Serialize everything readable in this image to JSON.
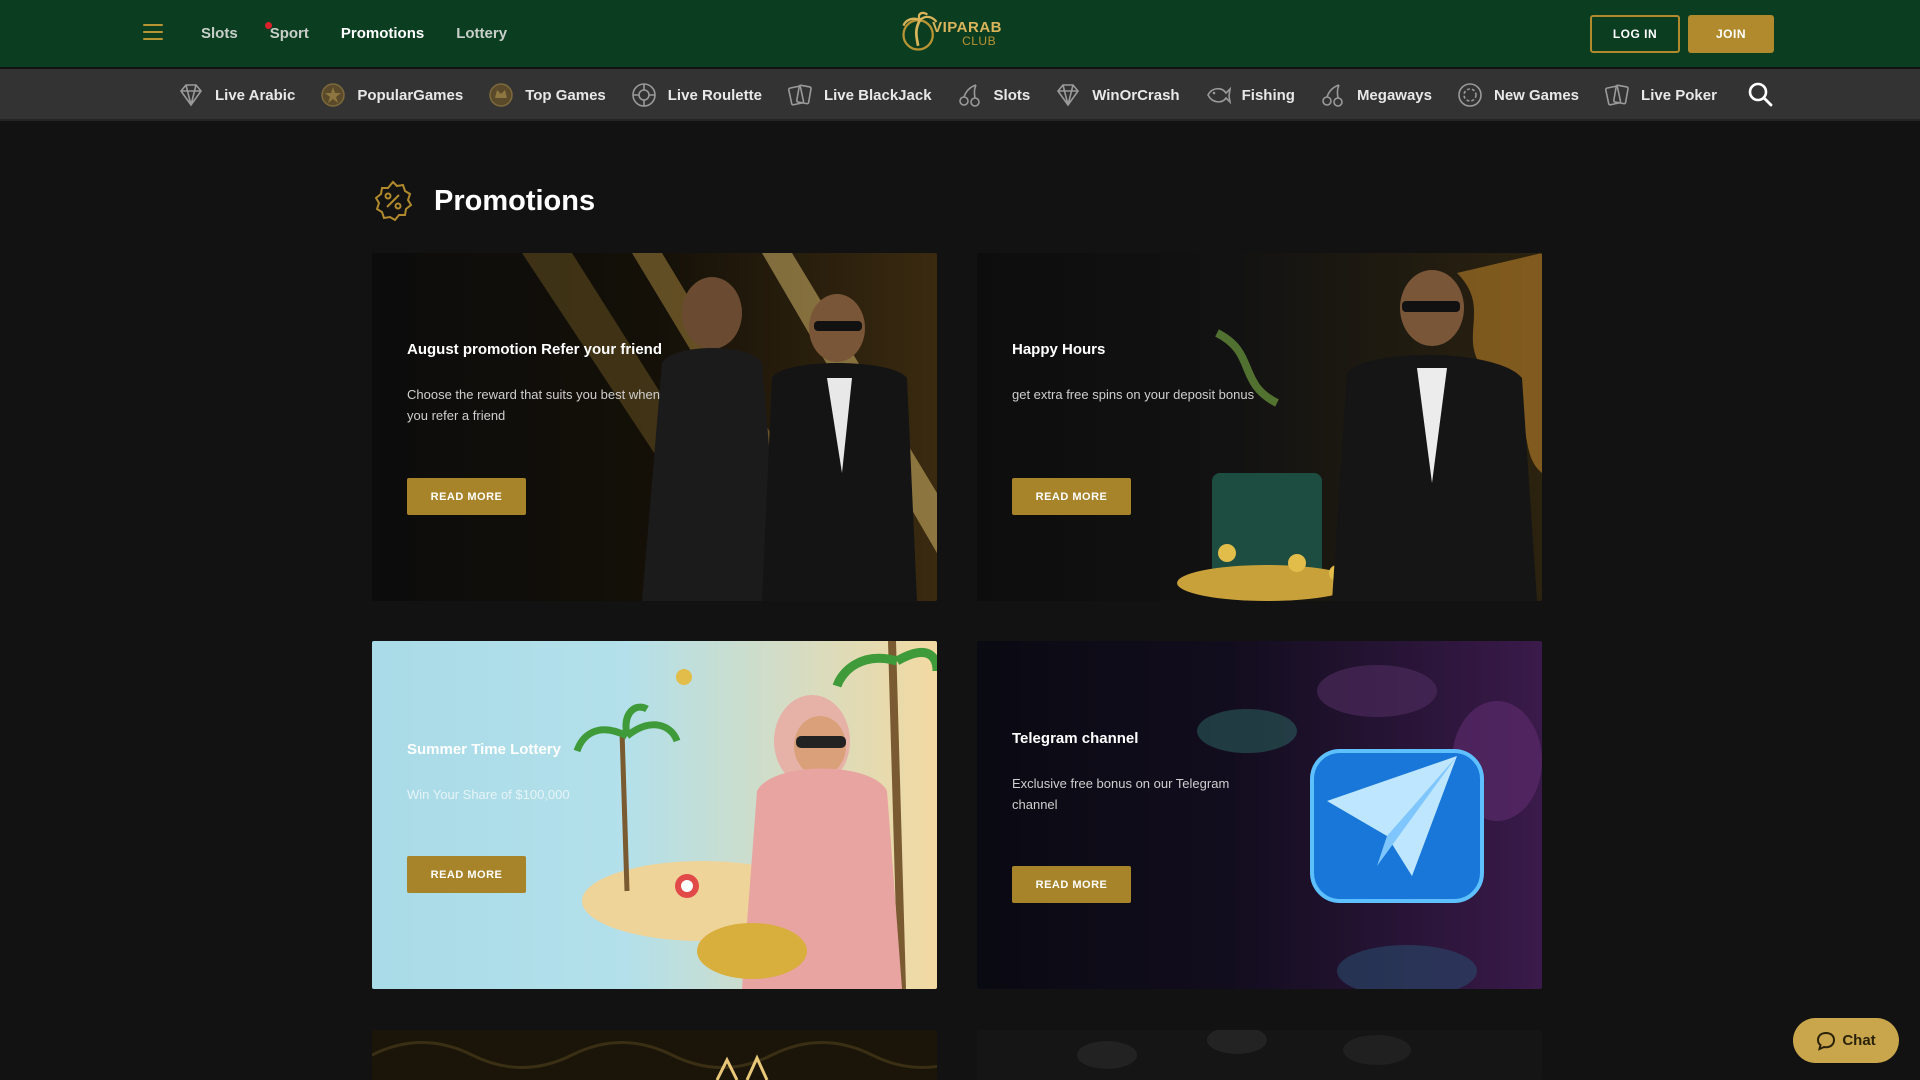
{
  "header": {
    "nav": [
      {
        "label": "Slots",
        "active": false,
        "dot": false
      },
      {
        "label": "Sport",
        "active": false,
        "dot": true
      },
      {
        "label": "Promotions",
        "active": true,
        "dot": false
      },
      {
        "label": "Lottery",
        "active": false,
        "dot": false
      }
    ],
    "logo": {
      "line1": "VIPARAB",
      "line2": "CLUB"
    },
    "login_label": "LOG IN",
    "join_label": "JOIN"
  },
  "categories": [
    {
      "label": "Live Arabic",
      "icon": "diamond-icon"
    },
    {
      "label": "PopularGames",
      "icon": "popular-games-icon"
    },
    {
      "label": "Top Games",
      "icon": "top-games-icon"
    },
    {
      "label": "Live Roulette",
      "icon": "roulette-icon"
    },
    {
      "label": "Live BlackJack",
      "icon": "cards-icon"
    },
    {
      "label": "Slots",
      "icon": "cherries-icon"
    },
    {
      "label": "WinOrCrash",
      "icon": "diamond-icon"
    },
    {
      "label": "Fishing",
      "icon": "fish-icon"
    },
    {
      "label": "Megaways",
      "icon": "cherries-icon"
    },
    {
      "label": "New Games",
      "icon": "chip-icon"
    },
    {
      "label": "Live Poker",
      "icon": "cards-icon"
    }
  ],
  "page": {
    "title": "Promotions"
  },
  "promotions": [
    {
      "title": "August promotion Refer your friend",
      "description": "Choose the reward that suits you best when you refer a friend",
      "button": "READ MORE"
    },
    {
      "title": "Happy Hours",
      "description": "get extra free spins on your deposit bonus",
      "button": "READ MORE"
    },
    {
      "title": "Summer Time Lottery",
      "description": "Win Your Share of $100,000",
      "button": "READ MORE"
    },
    {
      "title": "Telegram channel",
      "description": "Exclusive free bonus on our Telegram channel",
      "button": "READ MORE"
    }
  ],
  "chat": {
    "label": "Chat"
  },
  "colors": {
    "header_bg": "#0b3d21",
    "accent_gold": "#b08a2c",
    "catbar_bg": "#333333",
    "page_bg": "#121212"
  }
}
